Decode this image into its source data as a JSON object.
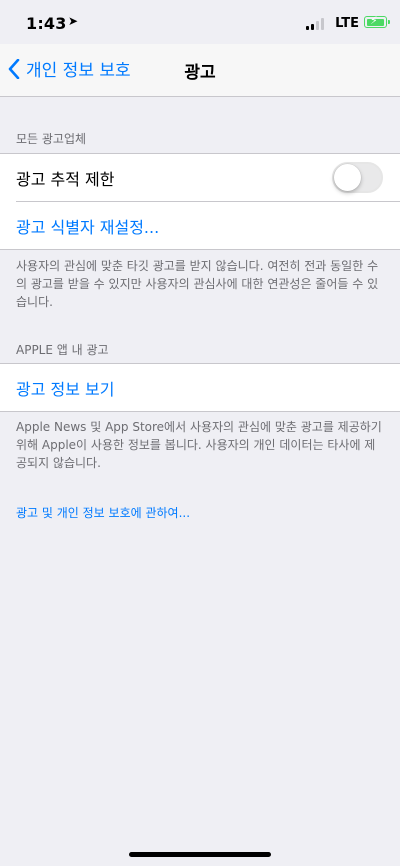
{
  "status_bar": {
    "time": "1:43",
    "carrier": "LTE"
  },
  "nav": {
    "back_label": "개인 정보 보호",
    "title": "광고"
  },
  "section_all": {
    "header": "모든 광고업체",
    "limit_tracking_label": "광고 추적 제한",
    "limit_tracking_on": false,
    "reset_identifier_label": "광고 식별자 재설정...",
    "footer": "사용자의 관심에 맞춘 타깃 광고를 받지 않습니다. 여전히 전과 동일한 수의 광고를 받을 수 있지만 사용자의 관심사에 대한 연관성은 줄어들 수 있습니다."
  },
  "section_apple": {
    "header": "APPLE 앱 내 광고",
    "view_info_label": "광고 정보 보기",
    "footer": "Apple News 및 App Store에서 사용자의 관심에 맞춘 광고를 제공하기 위해 Apple이 사용한 정보를 봅니다. 사용자의 개인 데이터는 타사에 제공되지 않습니다."
  },
  "about_link": "광고 및 개인 정보 보호에 관하여...",
  "colors": {
    "accent": "#007aff",
    "toggle_off": "#e9e9ea",
    "battery": "#4cd964"
  }
}
